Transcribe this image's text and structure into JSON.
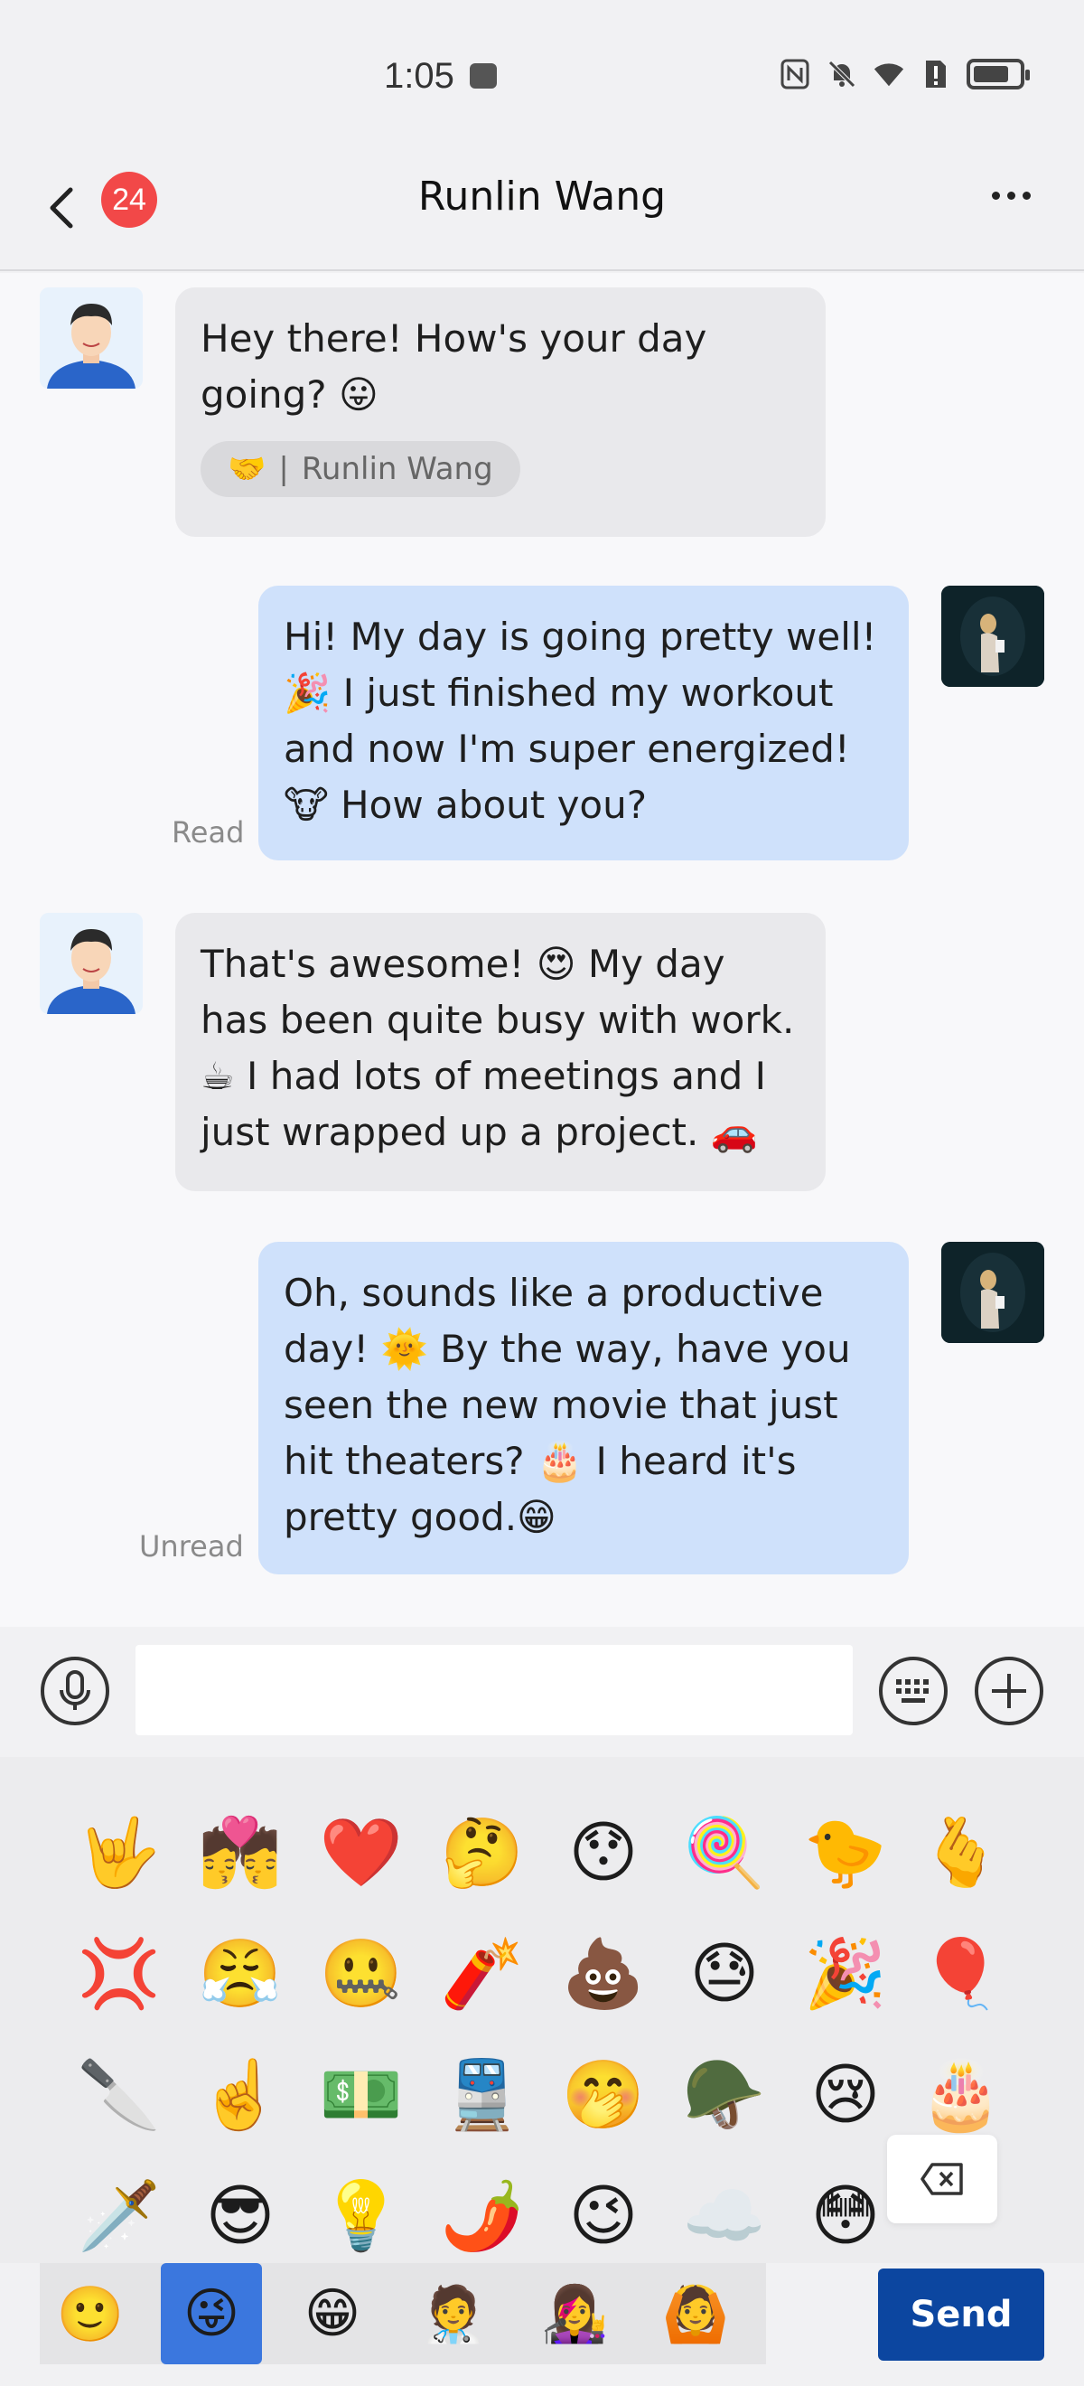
{
  "status_bar": {
    "time": "1:05"
  },
  "header": {
    "unread_count": "24",
    "title": "Runlin Wang"
  },
  "messages": [
    {
      "direction": "in",
      "text": "Hey there! How's your day going? 😛",
      "quote": {
        "emoji": "🤝",
        "separator": "|",
        "name": "Runlin Wang"
      }
    },
    {
      "direction": "out",
      "text": "Hi! My day is going pretty well! 🎉 I just finished my workout and now I'm super energized! 🐮 How about you?",
      "status": "Read"
    },
    {
      "direction": "in",
      "text": "That's awesome! 😍 My day has been quite busy with work. ☕ I had lots of meetings and I just wrapped up a project. 🚗"
    },
    {
      "direction": "out",
      "text": "Oh, sounds like a productive day! 🌞 By the way, have you seen the new movie that just hit theaters? 🎂 I heard it's pretty good.😁",
      "status": "Unread"
    }
  ],
  "input": {
    "value": "",
    "placeholder": ""
  },
  "emoji_grid": [
    [
      "🤟",
      "💏",
      "❤️",
      "🤔",
      "😯",
      "🍭",
      "🐤",
      "🫰"
    ],
    [
      "💢",
      "😤",
      "🤐",
      "🧨",
      "💩",
      "😓",
      "🎉",
      "🎈"
    ],
    [
      "🔪",
      "☝️",
      "💵",
      "🚆",
      "🤭",
      "🪖",
      "😢",
      "🎂"
    ],
    [
      "🗡️",
      "😎",
      "💡",
      "🌶️",
      "😉",
      "☁️",
      "😳",
      ""
    ]
  ],
  "tabs": [
    "🙂",
    "😜",
    "😁",
    "🧑‍⚕️",
    "👩‍🎤",
    "🙆"
  ],
  "send_label": "Send",
  "colors": {
    "incoming_bubble": "#e9e9ec",
    "outgoing_bubble": "#cfe1fb",
    "badge": "#f24848",
    "send_button": "#0c46a0",
    "active_tab": "#3b77de"
  }
}
